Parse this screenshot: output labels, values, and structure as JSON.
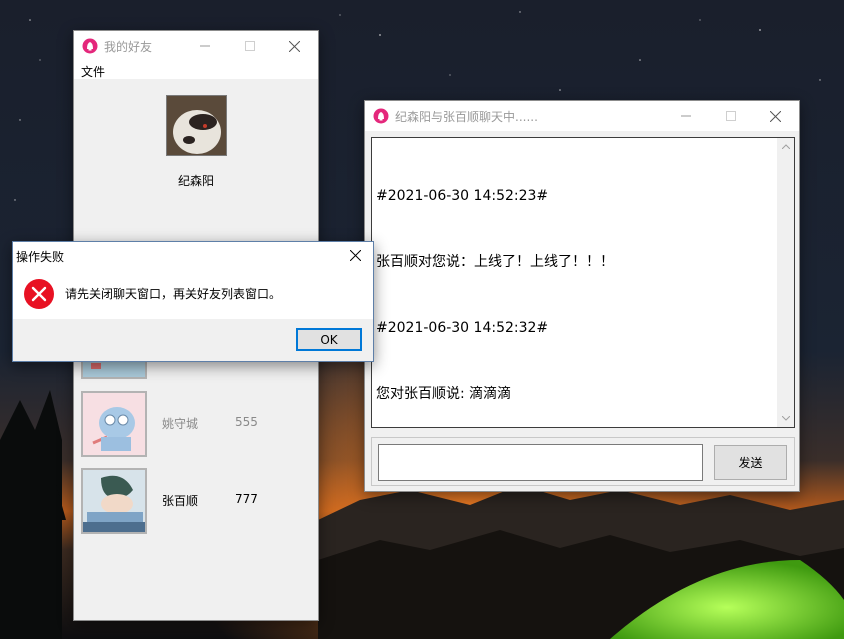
{
  "friends_window": {
    "title": "我的好友",
    "menu": [
      "文件"
    ],
    "self": {
      "name": "纪森阳"
    },
    "friends": [
      {
        "name": "姚守城",
        "id": "555",
        "online": false
      },
      {
        "name": "张百顺",
        "id": "777",
        "online": true
      }
    ]
  },
  "chat_window": {
    "title": "纪森阳与张百顺聊天中......",
    "messages": [
      "#2021-06-30 14:52:23#",
      "张百顺对您说：上线了！上线了！！！",
      "#2021-06-30 14:52:32#",
      "您对张百顺说: 滴滴滴"
    ],
    "input_value": "",
    "send_label": "发送"
  },
  "error_dialog": {
    "title": "操作失败",
    "message": "请先关闭聊天窗口，再关好友列表窗口。",
    "ok_label": "OK"
  },
  "colors": {
    "app_icon": "#e4277b",
    "error_icon": "#e81123",
    "dialog_focus": "#0078d7"
  },
  "icons": {
    "app": "penguin-bell-icon",
    "minimize": "minimize-icon",
    "maximize": "maximize-icon",
    "close": "close-icon",
    "error": "error-x-icon"
  }
}
